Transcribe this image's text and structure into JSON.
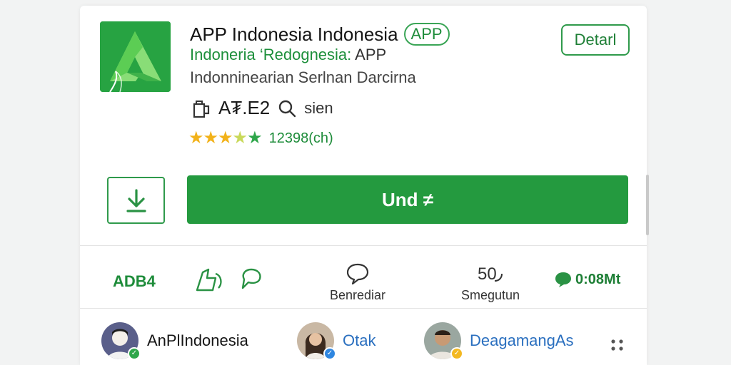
{
  "app": {
    "title": "APP Indonesia Indonesia",
    "badge": "APP",
    "subtitle_green": "Indoneria ‘Redognesia:",
    "subtitle_rest": " APP",
    "developer": "Indonninearian Serlnan Darcirna",
    "price": "A₮.E2",
    "size": "sien",
    "rating_count": "12398(ch)",
    "rating_stars": 4.5,
    "icon_name": "stylized-a-app-icon",
    "accent_color": "#249a3f"
  },
  "buttons": {
    "detail": "Detarl",
    "install": "Und ≠"
  },
  "actions": {
    "left_label": "ADB4",
    "comment_label": "Benrediar",
    "share_label": "Smegutun",
    "share_glyph": "50",
    "chat_label": "0:08Mt"
  },
  "users": [
    {
      "name": "AnPlIndonesia",
      "verified_color": "#2ea64a"
    },
    {
      "name": "Otak",
      "verified_color": "#2f86e0"
    },
    {
      "name": "DeagamangAs",
      "verified_color": "#f3b821"
    }
  ]
}
